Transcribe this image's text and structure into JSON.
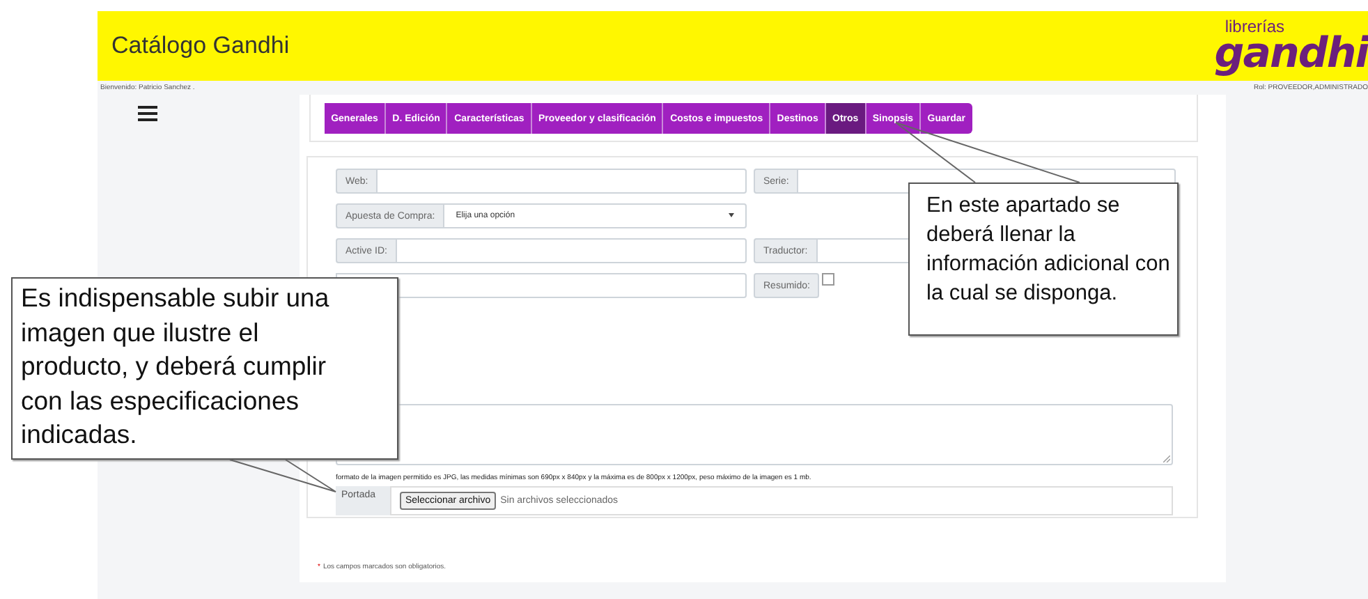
{
  "header": {
    "title": "Catálogo Gandhi",
    "logo_small": "librerías",
    "logo_large": "gandhi"
  },
  "user_bar": {
    "welcome": "Bienvenido: Patricio Sanchez .",
    "role": "Rol: PROVEEDOR,ADMINISTRADO"
  },
  "tabs": [
    {
      "label": "Generales",
      "selected": false
    },
    {
      "label": "D. Edición",
      "selected": false
    },
    {
      "label": "Características",
      "selected": false
    },
    {
      "label": "Proveedor y clasificación",
      "selected": false
    },
    {
      "label": "Costos e impuestos",
      "selected": false
    },
    {
      "label": "Destinos",
      "selected": false
    },
    {
      "label": "Otros",
      "selected": true
    },
    {
      "label": "Sinopsis",
      "selected": false
    },
    {
      "label": "Guardar",
      "selected": false
    }
  ],
  "form": {
    "rows": [
      [
        {
          "kind": "text",
          "label": "Web:"
        },
        {
          "kind": "text",
          "label": "Serie:"
        }
      ],
      [
        {
          "kind": "select",
          "label": "Apuesta de Compra:",
          "value": "Elija una opción"
        }
      ],
      [
        {
          "kind": "text",
          "label": "Active ID:"
        },
        {
          "kind": "text",
          "label": "Traductor:"
        }
      ],
      [
        {
          "kind": "text"
        },
        {
          "kind": "checkbox",
          "label": "Resumido:",
          "checked": false
        }
      ]
    ],
    "image_note": "formato de la imagen permitido es JPG, las medidas mínimas son 690px x 840px y la máxima es de 800px x 1200px, peso máximo de la imagen es 1 mb.",
    "cover": {
      "label": "Portada",
      "button": "Seleccionar archivo",
      "status": "Sin archivos seleccionados"
    }
  },
  "required_note": {
    "mark": "*",
    "text": "Los campos marcados son obligatorios."
  },
  "callouts": [
    {
      "text": "En este apartado se deberá llenar la información adicional con la cual se disponga."
    },
    {
      "text": "Es indispensable subir una imagen que ilustre el producto, y deberá cumplir con las especificaciones indicadas."
    }
  ]
}
